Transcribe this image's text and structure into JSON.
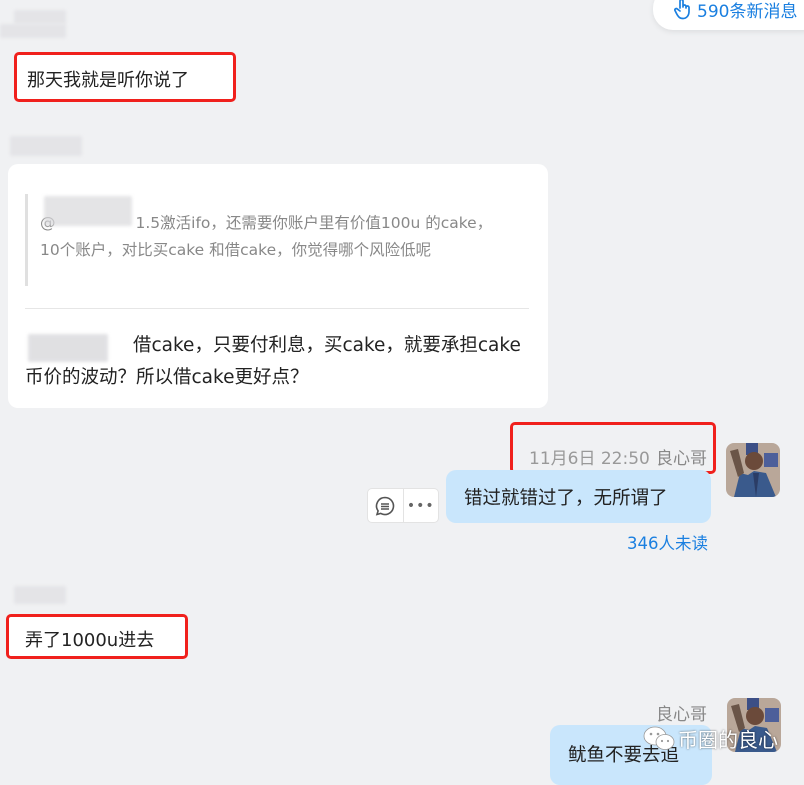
{
  "new_messages_pill": {
    "icon": "hand-pointer-icon",
    "label": "590条新消息"
  },
  "messages": [
    {
      "side": "in",
      "sender": "blurred",
      "text": "那天我就是听你说了",
      "highlighted": true
    },
    {
      "side": "in",
      "sender": "blurred",
      "quote": {
        "mention": "@",
        "text": "1.5激活ifo，还需要你账户里有价值100u 的cake，10个账户，对比买cake 和借cake，你觉得哪个风险低呢"
      },
      "text": "借cake，只要付利息，买cake，就要承担cake币价的波动？所以借cake更好点？"
    },
    {
      "side": "out",
      "timestamp": "11月6日 22:50",
      "sender": "良心哥",
      "text": "错过就错过了，无所谓了",
      "unread": "346人未读",
      "meta_highlighted": true,
      "actions": [
        "reply-bubble-icon",
        "more-dots-icon"
      ]
    },
    {
      "side": "in",
      "sender": "blurred",
      "text": "弄了1000u进去",
      "highlighted": true
    },
    {
      "side": "out",
      "sender": "良心哥",
      "text": "鱿鱼不要去追"
    }
  ],
  "watermark": {
    "icon": "wechat-icon",
    "text": "币圈的良心"
  },
  "colors": {
    "accent": "#1a7fe0",
    "highlight": "#f0201c",
    "bubble_out": "#c9e6fc",
    "background": "#f0f1f3"
  }
}
